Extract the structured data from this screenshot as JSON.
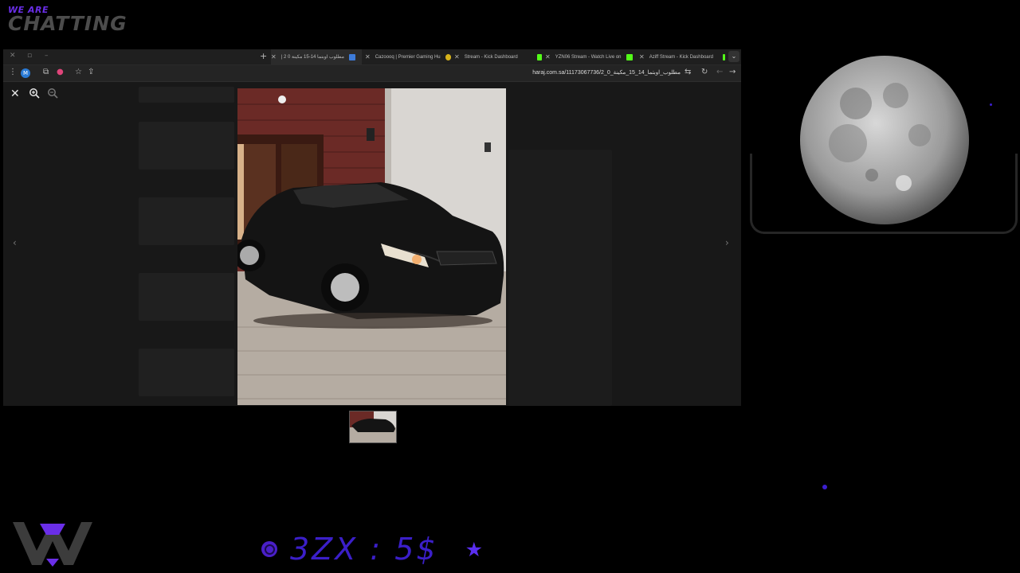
{
  "overlay": {
    "brand_small": "WE ARE",
    "brand_big": "CHATTING",
    "ticker": "3ZX : 5$"
  },
  "browser": {
    "tabs": [
      {
        "title": "مطلوب اوبتما 14-15 مكينة 0 2 |",
        "active": true,
        "favicon_color": "#3d7bd9"
      },
      {
        "title": "Cazoooq | Premier Gaming Hu",
        "active": false,
        "favicon_color": "#d6b21a"
      },
      {
        "title": "Stream - Kick Dashboard",
        "active": false,
        "favicon_color": "#53fc18"
      },
      {
        "title": "YZN06 Stream - Watch Live on",
        "active": false,
        "favicon_color": "#53fc18"
      },
      {
        "title": "Aziff Stream - Kick Dashboard",
        "active": false,
        "favicon_color": "#53fc18"
      }
    ],
    "url": "haraj.com.sa/11173067736/مطلوب_اوبتما_14_15_مكينة_0_2",
    "profile_initial": "M"
  },
  "viewer": {
    "close_icon": "close-icon",
    "zoom_in_icon": "zoom-in-icon",
    "zoom_out_icon": "zoom-out-icon",
    "prev_icon": "chevron-left-icon",
    "next_icon": "chevron-right-icon"
  },
  "colors": {
    "accent_purple": "#5a2ef0",
    "kick_green": "#53fc18",
    "viewer_bg": "#181818"
  }
}
